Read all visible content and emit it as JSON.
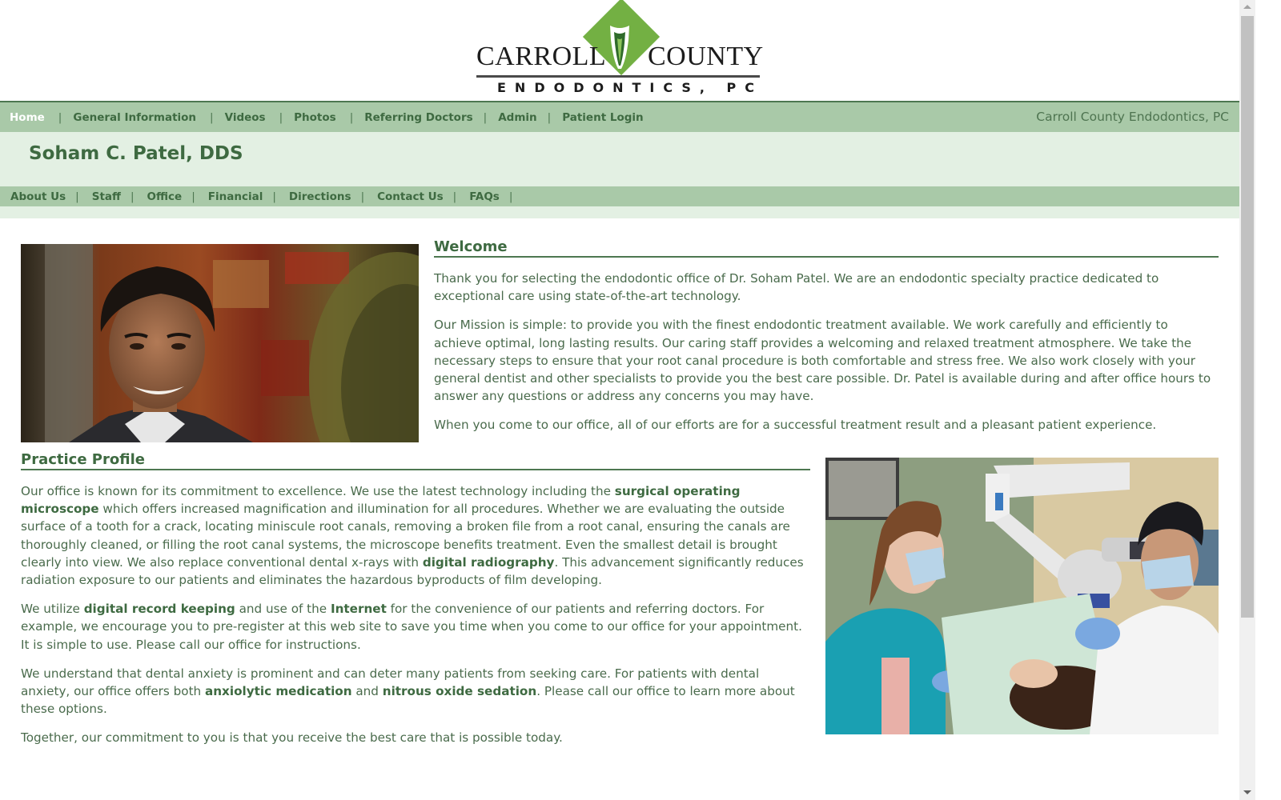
{
  "logo": {
    "word_left": "CARROLL",
    "word_right": "COUNTY",
    "subtitle": "ENDODONTICS, PC",
    "brand_green": "#73b043"
  },
  "main_nav": {
    "items": [
      {
        "label": "Home",
        "active": true
      },
      {
        "label": "General Information"
      },
      {
        "label": "Videos"
      },
      {
        "label": "Photos"
      },
      {
        "label": "Referring Doctors"
      },
      {
        "label": "Admin"
      },
      {
        "label": "Patient Login"
      }
    ],
    "separator": "|",
    "site_name": "Carroll County Endodontics, PC"
  },
  "header": {
    "title": "Soham C. Patel, DDS"
  },
  "sub_nav": {
    "items": [
      "About Us",
      "Staff",
      "Office",
      "Financial",
      "Directions",
      "Contact Us",
      "FAQs"
    ],
    "separator": "|"
  },
  "images": {
    "portrait": "portrait-photo-of-dr-patel",
    "clinic": "photo-of-dentist-using-microscope"
  },
  "welcome": {
    "heading": "Welcome",
    "paragraphs": [
      "Thank you for selecting the endodontic office of Dr. Soham Patel.  We are an endodontic specialty practice dedicated to exceptional care using state-of-the-art technology.",
      "Our Mission is simple: to provide you with the finest endodontic treatment available.  We work carefully and efficiently to achieve optimal, long lasting results.  Our caring staff provides a welcoming and relaxed treatment atmosphere.  We take the necessary steps to ensure that your root canal procedure is both comfortable and stress free.  We also work closely with your general dentist and other specialists to provide you the best care possible.  Dr. Patel is available during and after office hours to answer any questions or address any concerns you may have.",
      "When you come to our office, all of our efforts are for a successful treatment result and a pleasant patient experience."
    ]
  },
  "practice_profile": {
    "heading": "Practice Profile",
    "p1": {
      "a": "Our office is known for its commitment to excellence.  We use the latest technology including the ",
      "b1": "surgical operating microscope",
      "c": " which offers increased magnification and illumination for all procedures.  Whether we are evaluating the outside surface of a tooth for a crack, locating miniscule root canals, removing a broken file from a root canal, ensuring the canals are thoroughly cleaned, or filling the root canal systems, the microscope benefits treatment.   Even the smallest detail is brought clearly into view.  We also replace conventional dental x-rays with ",
      "b2": "digital radiography",
      "d": ". This advancement significantly reduces radiation exposure to our patients and eliminates the hazardous byproducts of film developing."
    },
    "p2": {
      "a": "We utilize ",
      "b1": "digital record keeping",
      "c": " and use of the ",
      "b2": "Internet",
      "d": " for the convenience of our patients and referring doctors.  For example, we encourage you to pre-register at this web site to save you time when you come to our office for your appointment.  It is simple to use.  Please call our office for instructions."
    },
    "p3": {
      "a": "We understand that dental anxiety is prominent and can deter many patients from seeking care.  For patients with dental anxiety, our office offers both ",
      "b1": "anxiolytic medication",
      "c": " and ",
      "b2": "nitrous oxide sedation",
      "d": ".  Please call our office to learn more about these options."
    },
    "p4": "Together, our commitment to you is that you receive the best care that is possible today."
  },
  "colors": {
    "nav_bg": "#a9c9a8",
    "band_bg": "#e3f0e3",
    "text_green": "#3e6a41"
  }
}
